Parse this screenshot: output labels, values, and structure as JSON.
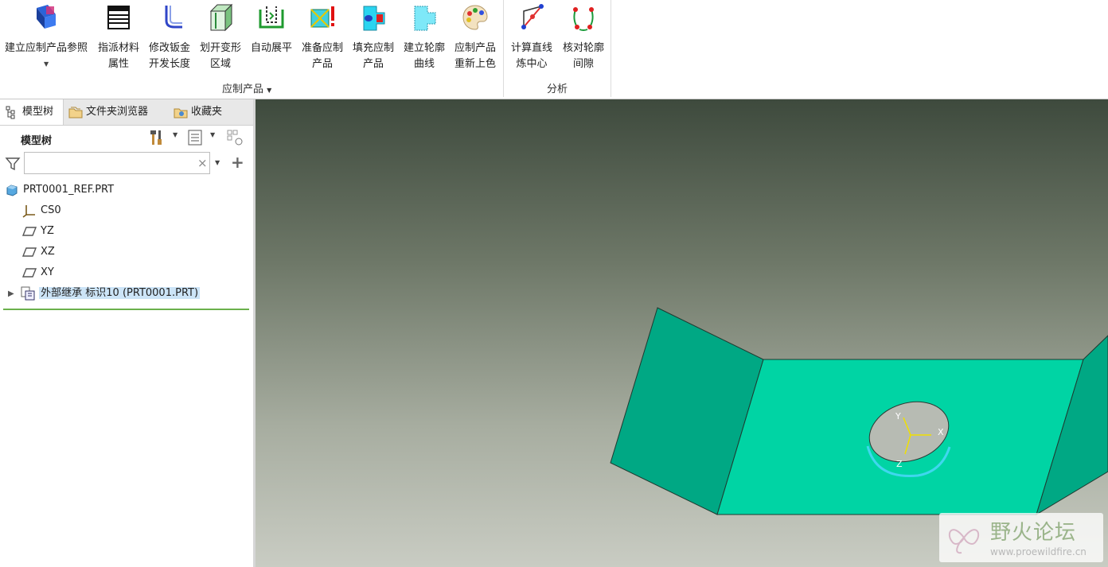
{
  "ribbon": {
    "buttons": [
      {
        "line1": "建立应制产品参照",
        "line2": ""
      },
      {
        "line1": "指派材料",
        "line2": "属性"
      },
      {
        "line1": "修改钣金",
        "line2": "开发长度"
      },
      {
        "line1": "划开变形",
        "line2": "区域"
      },
      {
        "line1": "自动展平",
        "line2": ""
      },
      {
        "line1": "准备应制",
        "line2": "产品"
      },
      {
        "line1": "填充应制",
        "line2": "产品"
      },
      {
        "line1": "建立轮廓",
        "line2": "曲线"
      },
      {
        "line1": "应制产品",
        "line2": "重新上色"
      },
      {
        "line1": "计算直线",
        "line2": "炼中心"
      },
      {
        "line1": "核对轮廓",
        "line2": "间隙"
      }
    ],
    "groups": {
      "product": "应制产品",
      "analysis": "分析"
    }
  },
  "panel": {
    "tabs": [
      "模型树",
      "文件夹浏览器",
      "收藏夹"
    ],
    "tree_title": "模型树",
    "search": {
      "value": "",
      "clear": "×"
    },
    "nodes": [
      "PRT0001_REF.PRT",
      "CS0",
      "YZ",
      "XZ",
      "XY",
      "外部继承 标识10 (PRT0001.PRT)"
    ]
  },
  "viewport": {
    "axes": {
      "x": "X",
      "y": "Y",
      "z": "Z"
    },
    "watermark": {
      "title": "野火论坛",
      "url": "www.proewildfire.cn"
    }
  },
  "colors": {
    "part": "#00d4a4",
    "part_side": "#00a884",
    "edge_highlight": "#3fd7ee",
    "selection": "#cce4f7",
    "active_line": "#6ab04c"
  }
}
